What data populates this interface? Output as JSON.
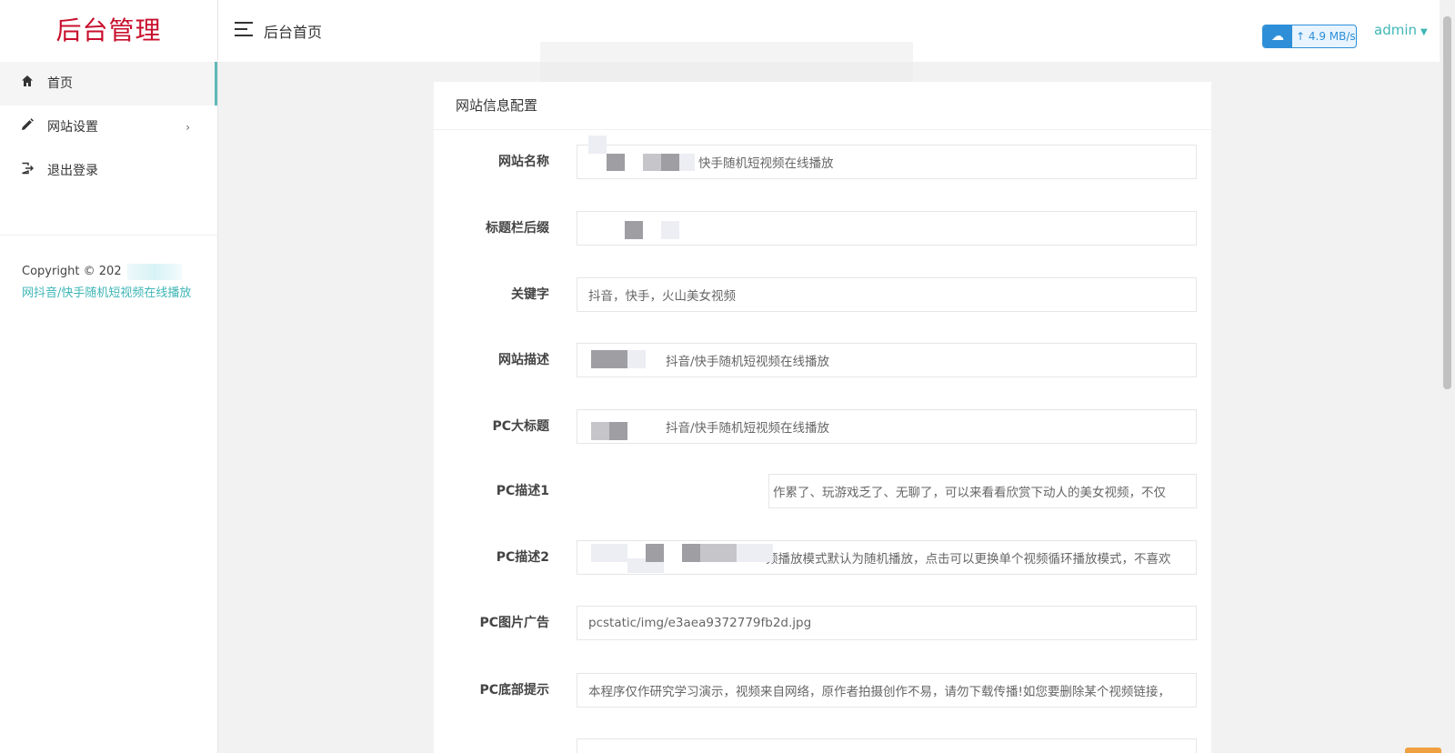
{
  "app": {
    "logo_text": "后台管理"
  },
  "sidebar": {
    "items": [
      {
        "label": "首页",
        "icon": "home-icon"
      },
      {
        "label": "网站设置",
        "icon": "pencil-icon",
        "has_submenu": true
      },
      {
        "label": "退出登录",
        "icon": "logout-icon"
      }
    ],
    "copyright": "Copyright © 202",
    "site_link": "网抖音/快手随机短视频在线播放"
  },
  "header": {
    "breadcrumb": "后台首页",
    "speed": "4.9 MB/s",
    "user": "admin"
  },
  "card": {
    "title": "网站信息配置",
    "fields": [
      {
        "label": "网站名称",
        "value": "快手随机短视频在线播放"
      },
      {
        "label": "标题栏后缀",
        "value": ""
      },
      {
        "label": "关键字",
        "value": "抖音，快手，火山美女视频"
      },
      {
        "label": "网站描述",
        "value": "抖音/快手随机短视频在线播放"
      },
      {
        "label": "PC大标题",
        "value": "抖音/快手随机短视频在线播放"
      },
      {
        "label": "PC描述1",
        "value": "作累了、玩游戏乏了、无聊了，可以来看看欣赏下动人的美女视频，不仅"
      },
      {
        "label": "PC描述2",
        "value": "频播放模式默认为随机播放，点击可以更换单个视频循环播放模式，不喜欢"
      },
      {
        "label": "PC图片广告",
        "value": "pcstatic/img/e3aea9372779fb2d.jpg"
      },
      {
        "label": "PC底部提示",
        "value": "本程序仅作研究学习演示，视频来自网络，原作者拍摄创作不易，请勿下载传播!如您要删除某个视频链接，"
      }
    ]
  },
  "colors": {
    "logo": "#c8102e",
    "accent": "#3fb6b6",
    "badge": "#2e8fd8"
  }
}
